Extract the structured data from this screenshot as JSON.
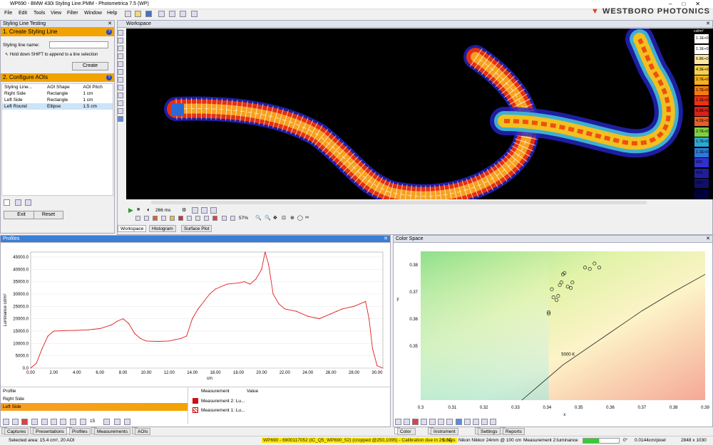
{
  "window": {
    "title": "WP690 - BMW 430i Styling Line.PMM - Photometrica 7.5 (WP)",
    "brand": "WESTBORO PHOTONICS"
  },
  "menu": [
    "File",
    "Edit",
    "Tools",
    "View",
    "Filter",
    "Window",
    "Help"
  ],
  "left_panel": {
    "title": "Styling Line Testing",
    "section1": "1. Create Styling Line",
    "name_label": "Styling line name:",
    "name_value": "",
    "hint": "Hold down SHIFT to append to a line selection",
    "create_btn": "Create",
    "section2": "2. Configure AOIs",
    "columns": [
      "Styling Line...",
      "AOI Shape",
      "AOI Pitch"
    ],
    "rows": [
      [
        "Right Side",
        "Rectangle",
        "1 cm"
      ],
      [
        "Left Side",
        "Rectangle",
        "1 cm"
      ],
      [
        "Left Round",
        "Ellipse",
        "1.5 cm"
      ]
    ],
    "exit_btn": "Exit",
    "reset_btn": "Reset"
  },
  "workspace": {
    "title": "Workspace",
    "exposure": "266 ms",
    "zoom": "57%",
    "tabs": [
      "Workspace",
      "Histogram",
      "Surface Plot"
    ],
    "scale_unit": "cd/m²",
    "scale": [
      "1.1E+05",
      "1.1E+05",
      "6.8E+04",
      "4.3E+04",
      "2.7E+04",
      "1.7E+04",
      "1.1E+04",
      "6.8E+03",
      "4.2E+03",
      "2.7E+03",
      "1.7E+03",
      "1.1E+03",
      "666",
      "419",
      "264",
      "150"
    ],
    "scale_colors": [
      "#ffffff",
      "#ffffff",
      "#fbe7a0",
      "#f6cf4d",
      "#f7b020",
      "#f47a10",
      "#ee3010",
      "#d9201a",
      "#e86020",
      "#7fd040",
      "#2ea8d0",
      "#2a7ad8",
      "#3030d0",
      "#1f1f9a",
      "#10106a",
      "#000040"
    ]
  },
  "profiles": {
    "title": "Profiles",
    "ylabel": "Luminance cd/m²",
    "xlabel": "cm",
    "legend_head": [
      "Measurement",
      "Value"
    ],
    "legend": [
      "Measurement 2: Lu...",
      "Measurement 1: Lu..."
    ],
    "list_header": "Profile",
    "list": [
      "Right Side",
      "Left Side"
    ],
    "page": "15"
  },
  "chart_data": [
    {
      "type": "line",
      "title": "",
      "xlabel": "cm",
      "ylabel": "Luminance cd/m²",
      "xlim": [
        0,
        30.5
      ],
      "ylim": [
        0,
        47000
      ],
      "x": [
        0,
        0.5,
        1,
        1.5,
        2,
        3,
        4,
        5,
        6,
        7,
        7.5,
        8,
        8.5,
        9,
        9.5,
        10,
        11,
        12,
        12.5,
        13,
        13.5,
        14,
        14.5,
        15,
        15.5,
        16,
        17,
        18,
        18.5,
        19,
        19.5,
        20,
        20.3,
        20.6,
        21,
        21.5,
        22,
        23,
        24,
        25,
        26,
        26.5,
        27,
        28,
        28.5,
        29,
        29.3,
        29.6,
        30,
        30.5
      ],
      "y": [
        0,
        2000,
        8000,
        13000,
        15000,
        15200,
        15300,
        15500,
        16000,
        17500,
        19000,
        20000,
        18000,
        14000,
        12000,
        11000,
        10800,
        11000,
        11500,
        12000,
        13000,
        20000,
        24000,
        27000,
        30000,
        32000,
        34000,
        34500,
        35000,
        34000,
        36000,
        40000,
        47000,
        42000,
        30000,
        26000,
        24000,
        23000,
        21000,
        20000,
        22000,
        23000,
        24000,
        25000,
        26000,
        27000,
        20000,
        8000,
        1000,
        0
      ],
      "series": [
        {
          "name": "Measurement 2: Lu...",
          "color": "#e02020"
        }
      ]
    },
    {
      "type": "scatter",
      "title": "",
      "xlabel": "x",
      "ylabel": "y",
      "xlim": [
        0.3,
        0.39
      ],
      "ylim": [
        0.33,
        0.385
      ],
      "annotation": "5000 K",
      "xticks": [
        "0.3",
        "0.31",
        "0.32",
        "0.33",
        "0.34",
        "0.35",
        "0.36",
        "0.37",
        "0.38",
        "0.39"
      ],
      "yticks": [
        "0.35",
        "0.36",
        "0.37",
        "0.38"
      ],
      "points": [
        [
          0.3405,
          0.3625
        ],
        [
          0.3405,
          0.362
        ],
        [
          0.3415,
          0.371
        ],
        [
          0.342,
          0.368
        ],
        [
          0.343,
          0.367
        ],
        [
          0.3435,
          0.3685
        ],
        [
          0.344,
          0.3725
        ],
        [
          0.3445,
          0.3735
        ],
        [
          0.345,
          0.3765
        ],
        [
          0.3455,
          0.377
        ],
        [
          0.3465,
          0.372
        ],
        [
          0.3475,
          0.3715
        ],
        [
          0.348,
          0.3735
        ],
        [
          0.352,
          0.379
        ],
        [
          0.3535,
          0.3785
        ],
        [
          0.355,
          0.3805
        ],
        [
          0.3565,
          0.379
        ]
      ]
    }
  ],
  "color_space": {
    "title": "Color Space",
    "tabs": [
      "Color Space",
      "Instrument Status",
      "Settings",
      "Reports"
    ]
  },
  "bottom_tabs": [
    "Captures",
    "Presentations",
    "Profiles",
    "Measurements",
    "AOIs"
  ],
  "status": {
    "area": "Selected area: 15.4 cm², 20 AOI",
    "camera": "WP690 - 6900117052 (IC_Q5_WP690_52) (cropped @250,1095) - Calibration due in 26 days",
    "temp": "1 °C",
    "lens": "Nikon Nikkor 24mm @ 100 cm",
    "measure": "Measurement 2:luminance",
    "angle": "0°",
    "pixel": "0.0144cm/pixel",
    "res": "2848 x 1030"
  }
}
